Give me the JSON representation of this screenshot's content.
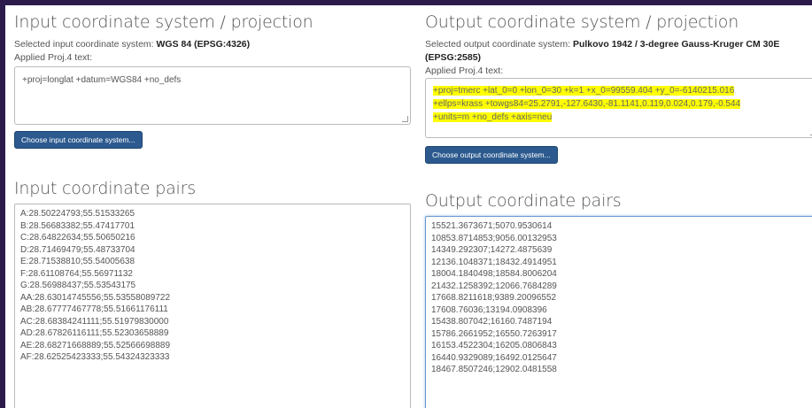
{
  "input": {
    "title": "Input coordinate system / projection",
    "selected_prefix": "Selected input coordinate system: ",
    "selected_name": "WGS 84 (EPSG:4326)",
    "proj_label": "Applied Proj.4 text:",
    "proj_text": "+proj=longlat +datum=WGS84 +no_defs",
    "choose_button": "Choose input coordinate system...",
    "pairs_title": "Input coordinate pairs",
    "pairs": [
      "A:28.50224793;55.51533265",
      "B:28.56683382;55.47417701",
      "C:28.64822634;55.50650216",
      "D:28.71469479;55.48733704",
      "E:28.71538810;55.54005638",
      "F:28.61108764;55.56971132",
      "G:28.56988437;55.53543175",
      "AA:28.63014745556;55.53558089722",
      "AB:28.67777467778;55.51661176111",
      "AC:28.68384241111;55.51979830000",
      "AD:28.67826116111;55.52303658889",
      "AE:28.68271668889;55.52566698889",
      "AF:28.62525423333;55.54324323333"
    ]
  },
  "output": {
    "title": "Output coordinate system / projection",
    "selected_prefix": "Selected output coordinate system: ",
    "selected_name": "Pulkovo 1942 / 3-degree Gauss-Kruger CM 30E",
    "selected_code": "(EPSG:2585)",
    "proj_label": "Applied Proj.4 text:",
    "proj_lines": [
      "+proj=tmerc +lat_0=0 +lon_0=30 +k=1 +x_0=99559.404 +y_0=-6140215.016",
      "+ellps=krass +towgs84=25.2791,-127.6430,-81.1141,0.119,0.024,0.179,-0.544",
      "+units=m +no_defs +axis=neu"
    ],
    "choose_button": "Choose output coordinate system...",
    "pairs_title": "Output coordinate pairs",
    "pairs": [
      "15521.3673671;5070.9530614",
      "10853.8714853;9056.00132953",
      "14349.292307;14272.4875639",
      "12136.1048371;18432.4914951",
      "18004.1840498;18584.8006204",
      "21432.1258392;12066.7684289",
      "17668.8211618;9389.20096552",
      "17608.76036;13194.0908396",
      "15438.807042;16160.7487194",
      "15786.2661952;16550.7263917",
      "16153.4522304;16205.0806843",
      "16440.9329089;16492.0125647",
      "18467.8507246;12902.0481558"
    ]
  },
  "colors": {
    "highlight": "#ffff00",
    "button": "#2c5a8f",
    "frame": "#2b1b4a"
  }
}
